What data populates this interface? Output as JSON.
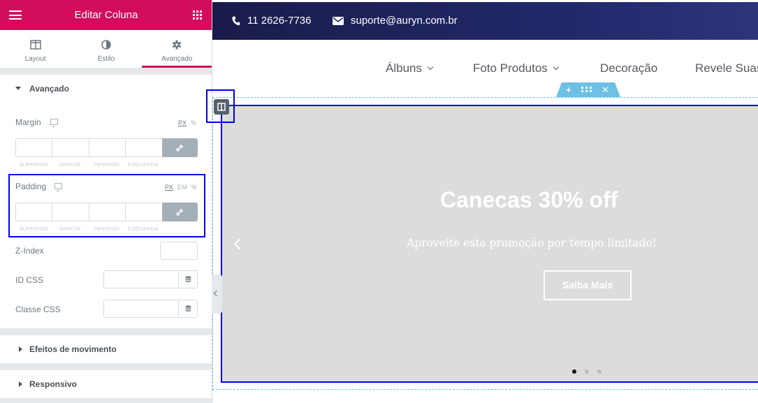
{
  "panel": {
    "title": "Editar Coluna",
    "tabs": [
      {
        "label": "Layout",
        "icon": "columns-icon"
      },
      {
        "label": "Estilo",
        "icon": "half-circle-icon"
      },
      {
        "label": "Avançado",
        "icon": "gear-icon",
        "active": true
      }
    ],
    "advanced": {
      "heading": "Avançado",
      "margin": {
        "label": "Margin",
        "units": [
          "PX",
          "%"
        ],
        "active_unit": "PX",
        "dim_labels": [
          "SUPERIOR",
          "DIREITA",
          "INFERIOR",
          "ESQUERDA"
        ],
        "values": [
          "",
          "",
          "",
          ""
        ]
      },
      "padding": {
        "label": "Padding",
        "units": [
          "PX",
          "EM",
          "%"
        ],
        "active_unit": "PX",
        "dim_labels": [
          "SUPERIOR",
          "DIREITA",
          "INFERIOR",
          "ESQUERDA"
        ],
        "values": [
          "",
          "",
          "",
          ""
        ]
      },
      "z_index": {
        "label": "Z-Index",
        "value": ""
      },
      "css_id": {
        "label": "ID CSS",
        "value": ""
      },
      "css_class": {
        "label": "Classe CSS",
        "value": ""
      }
    },
    "sections": [
      {
        "label": "Efeitos de movimento"
      },
      {
        "label": "Responsivo"
      }
    ],
    "accent_color": "#d30c5c"
  },
  "site": {
    "topbar": {
      "phone": "11 2626-7736",
      "email": "suporte@auryn.com.br"
    },
    "nav": [
      {
        "label": "Álbuns",
        "has_dropdown": true
      },
      {
        "label": "Foto Produtos",
        "has_dropdown": true
      },
      {
        "label": "Decoração",
        "has_dropdown": false
      },
      {
        "label": "Revele Suas",
        "has_dropdown": false
      }
    ],
    "slide": {
      "title": "Canecas 30% off",
      "subtitle": "Aproveite esta promoção por tempo limitado!",
      "button": "Saiba Mais",
      "dots": 3,
      "active_dot": 1
    }
  }
}
